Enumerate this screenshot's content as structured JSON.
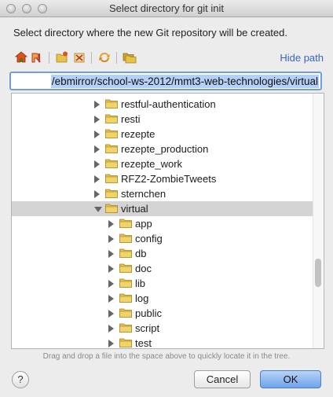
{
  "window": {
    "title": "Select directory for git init"
  },
  "instruction": "Select directory where the new Git repository will be created.",
  "toolbar": {
    "buttons": [
      "home-icon",
      "project-icon",
      "new-folder-icon",
      "delete-icon",
      "refresh-icon",
      "show-hidden-icon"
    ],
    "hide_path_label": "Hide path"
  },
  "path": {
    "value": "/ebmirror/school-ws-2012/mmt3-web-technologies/virtual"
  },
  "tree": {
    "items": [
      {
        "label": "restful-authentication",
        "level": 0,
        "expanded": false,
        "selected": false
      },
      {
        "label": "resti",
        "level": 0,
        "expanded": false,
        "selected": false
      },
      {
        "label": "rezepte",
        "level": 0,
        "expanded": false,
        "selected": false
      },
      {
        "label": "rezepte_production",
        "level": 0,
        "expanded": false,
        "selected": false
      },
      {
        "label": "rezepte_work",
        "level": 0,
        "expanded": false,
        "selected": false
      },
      {
        "label": "RFZ2-ZombieTweets",
        "level": 0,
        "expanded": false,
        "selected": false
      },
      {
        "label": "sternchen",
        "level": 0,
        "expanded": false,
        "selected": false
      },
      {
        "label": "virtual",
        "level": 0,
        "expanded": true,
        "selected": true
      },
      {
        "label": "app",
        "level": 1,
        "expanded": false,
        "selected": false
      },
      {
        "label": "config",
        "level": 1,
        "expanded": false,
        "selected": false
      },
      {
        "label": "db",
        "level": 1,
        "expanded": false,
        "selected": false
      },
      {
        "label": "doc",
        "level": 1,
        "expanded": false,
        "selected": false
      },
      {
        "label": "lib",
        "level": 1,
        "expanded": false,
        "selected": false
      },
      {
        "label": "log",
        "level": 1,
        "expanded": false,
        "selected": false
      },
      {
        "label": "public",
        "level": 1,
        "expanded": false,
        "selected": false
      },
      {
        "label": "script",
        "level": 1,
        "expanded": false,
        "selected": false
      },
      {
        "label": "test",
        "level": 1,
        "expanded": false,
        "selected": false
      }
    ]
  },
  "hint": "Drag and drop a file into the space above to quickly locate it in the tree.",
  "buttons": {
    "help": "?",
    "cancel": "Cancel",
    "ok": "OK"
  },
  "colors": {
    "selection": "#b5d0f7",
    "accent_link": "#3a64c4",
    "ok_button": "#6ea3ea",
    "folder": "#e6c24a"
  }
}
